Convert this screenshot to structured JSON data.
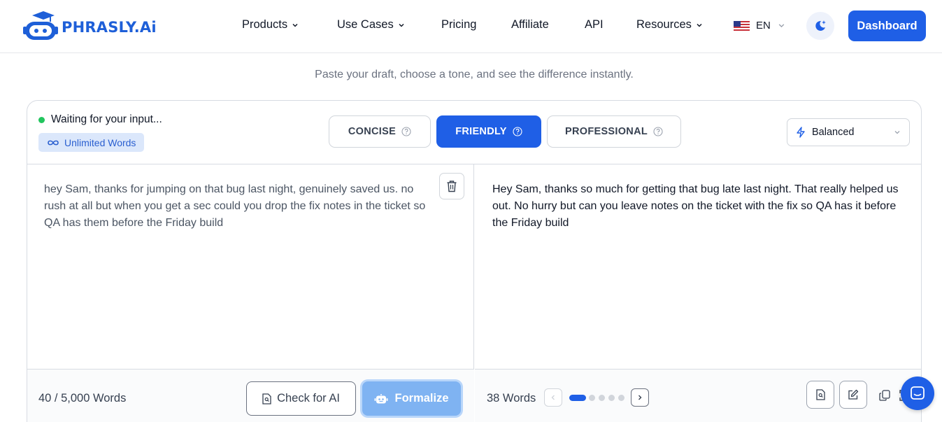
{
  "brand": {
    "name": "PHRASLY.Ai",
    "color": "#1e5fd8"
  },
  "nav": {
    "items": [
      {
        "label": "Products",
        "has_dropdown": true
      },
      {
        "label": "Use Cases",
        "has_dropdown": true
      },
      {
        "label": "Pricing",
        "has_dropdown": false
      },
      {
        "label": "Affiliate",
        "has_dropdown": false
      },
      {
        "label": "API",
        "has_dropdown": false
      },
      {
        "label": "Resources",
        "has_dropdown": true
      }
    ],
    "language": "EN",
    "theme_icon": "moon-sparkle-icon",
    "dashboard_label": "Dashboard"
  },
  "subtitle": "Paste your draft, choose a tone, and see the difference instantly.",
  "editor": {
    "status": "Waiting for your input...",
    "status_color": "#22c55e",
    "badge": "Unlimited Words",
    "tones": [
      {
        "label": "CONCISE",
        "active": false
      },
      {
        "label": "FRIENDLY",
        "active": true
      },
      {
        "label": "PROFESSIONAL",
        "active": false
      }
    ],
    "mode": "Balanced",
    "input_text": "hey Sam, thanks for jumping on that bug last night, genuinely saved us. no rush at all but when you get a sec could you drop the fix notes in the ticket so QA has them before the Friday build",
    "output_text": "Hey Sam, thanks so much for getting that bug late last night. That really helped us out.  No hurry but can you leave notes on the ticket with the fix so QA has it before the Friday build",
    "input_word_count": "40 / 5,000 Words",
    "check_ai_label": "Check for AI",
    "formalize_label": "Formalize",
    "output_word_count": "38 Words",
    "pagination": {
      "total": 5,
      "current": 1
    }
  },
  "colors": {
    "accent": "#1f5fe6",
    "formalize_disabled": "#7fb3f2"
  }
}
